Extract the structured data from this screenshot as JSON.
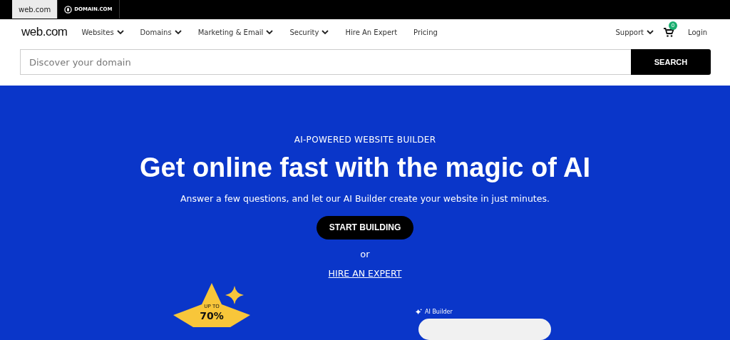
{
  "brand_tabs": [
    {
      "label": "web.com",
      "selected": true
    },
    {
      "label": "DOMAIN.COM",
      "selected": false
    }
  ],
  "nav": {
    "logo": "web.com",
    "items": [
      {
        "label": "Websites",
        "dropdown": true
      },
      {
        "label": "Domains",
        "dropdown": true
      },
      {
        "label": "Marketing & Email",
        "dropdown": true
      },
      {
        "label": "Security",
        "dropdown": true
      },
      {
        "label": "Hire An Expert",
        "dropdown": false
      },
      {
        "label": "Pricing",
        "dropdown": false
      }
    ],
    "support": "Support",
    "cart_count": "0",
    "login": "Login"
  },
  "search": {
    "placeholder": "Discover your domain",
    "button": "SEARCH"
  },
  "hero": {
    "eyebrow": "AI-POWERED WEBSITE BUILDER",
    "title": "Get online fast with the magic of AI",
    "subtitle": "Answer a few questions, and let our AI Builder create your website in just minutes.",
    "cta": "START BUILDING",
    "or": "or",
    "link": "HIRE AN EXPERT",
    "badge": {
      "line1": "UP TO",
      "line2": "70%"
    },
    "builder_label": "AI Builder"
  }
}
